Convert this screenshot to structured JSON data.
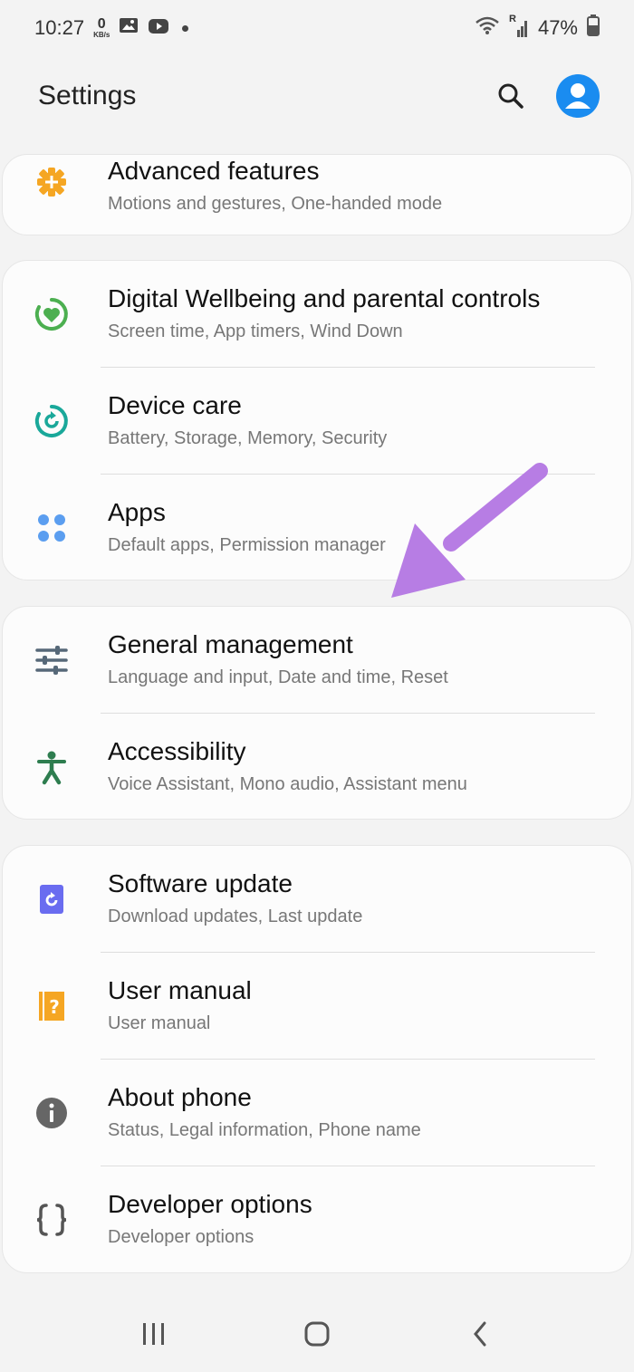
{
  "status_bar": {
    "time": "10:27",
    "net_speed_value": "0",
    "net_speed_unit": "KB/s",
    "network_type_letter": "R",
    "battery": "47%"
  },
  "header": {
    "title": "Settings"
  },
  "items": [
    {
      "label": "Advanced features",
      "sub": "Motions and gestures, One-handed mode",
      "icon": "plus-gear-icon",
      "color": "#f5a623"
    },
    {
      "label": "Digital Wellbeing and parental controls",
      "sub": "Screen time, App timers, Wind Down",
      "icon": "heart-ring-icon",
      "color": "#4caf50"
    },
    {
      "label": "Device care",
      "sub": "Battery, Storage, Memory, Security",
      "icon": "refresh-ring-icon",
      "color": "#1aa89a"
    },
    {
      "label": "Apps",
      "sub": "Default apps, Permission manager",
      "icon": "four-dots-icon",
      "color": "#5b9ef0"
    },
    {
      "label": "General management",
      "sub": "Language and input, Date and time, Reset",
      "icon": "sliders-icon",
      "color": "#566878"
    },
    {
      "label": "Accessibility",
      "sub": "Voice Assistant, Mono audio, Assistant menu",
      "icon": "accessibility-person-icon",
      "color": "#2e7d4f"
    },
    {
      "label": "Software update",
      "sub": "Download updates, Last update",
      "icon": "update-icon",
      "color": "#6a6cf0"
    },
    {
      "label": "User manual",
      "sub": "User manual",
      "icon": "question-book-icon",
      "color": "#f5a623"
    },
    {
      "label": "About phone",
      "sub": "Status, Legal information, Phone name",
      "icon": "info-icon",
      "color": "#666666"
    },
    {
      "label": "Developer options",
      "sub": "Developer options",
      "icon": "braces-icon",
      "color": "#555555"
    }
  ],
  "colors": {
    "background": "#f3f3f3",
    "card": "#fcfcfc",
    "accent": "#1a8cf0",
    "annotation_arrow": "#b77de4"
  }
}
